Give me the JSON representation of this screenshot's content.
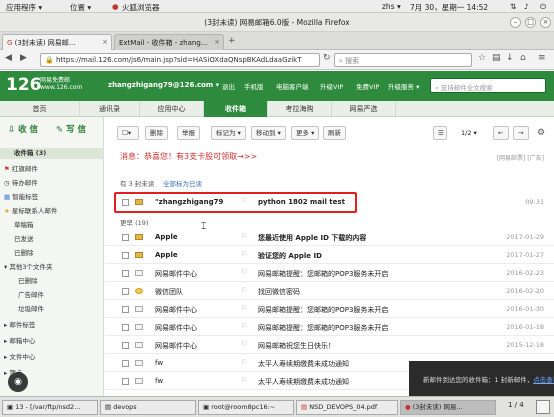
{
  "gnome": {
    "apps": "应用程序 ▾",
    "places": "位置 ▾",
    "app_name": "火狐浏览器",
    "user": "zhs ▾",
    "time": "7月 30，星期一 14:52",
    "status_icons": [
      "network-icon",
      "volume-icon",
      "power-icon"
    ]
  },
  "window": {
    "title": "(3封未读) 网易邮箱6.0版 - Mozilla Firefox"
  },
  "tabs": [
    {
      "label": "(3封未读) 网易邮...",
      "active": true
    },
    {
      "label": "ExtMail - 收件箱 - zhang...",
      "active": false
    }
  ],
  "nav": {
    "url": "https://mail.126.com/js6/main.jsp?sid=HASiOXdaQNspBKAdLdaaGzikT",
    "search_placeholder": "搜索"
  },
  "mail_header": {
    "logo": "126",
    "logo_sub1": "网易免费邮",
    "logo_sub2": "www.126.com",
    "user": "zhangzhigang79@126.com ▾",
    "links": [
      "退出",
      "手机版",
      "电脑客户端",
      "升级VIP",
      "免费VIP",
      "升级服务 ▾",
      "设置 ▾"
    ],
    "search_placeholder": "支持邮件全文搜索"
  },
  "mail_tabs": [
    "首页",
    "通讯录",
    "应用中心",
    "收件箱",
    "考拉海购",
    "网易严选"
  ],
  "sidebar": {
    "receive": "收 信",
    "compose": "写 信",
    "items": [
      {
        "label": "收件箱 (3)",
        "sel": true
      },
      {
        "label": "红旗邮件"
      },
      {
        "label": "待办邮件"
      },
      {
        "label": "智能标签"
      },
      {
        "label": "星标联系人邮件"
      },
      {
        "label": "草稿箱"
      },
      {
        "label": "已发送"
      },
      {
        "label": "已删除"
      },
      {
        "label": "其他3个文件夹"
      },
      {
        "label": "已删除"
      },
      {
        "label": "广告邮件"
      },
      {
        "label": "垃圾邮件"
      },
      {
        "label": "邮件标签"
      },
      {
        "label": "邮箱中心"
      },
      {
        "label": "文件中心"
      },
      {
        "label": "贺卡"
      }
    ]
  },
  "toolbar": {
    "delete": "删除",
    "report": "举报",
    "mark": "标记为 ▾",
    "move": "移动到 ▾",
    "more": "更多 ▾",
    "refresh": "刷新",
    "page": "1/2 ▾"
  },
  "promo": {
    "text": "消息：恭喜您！有3支卡股可领取→>>",
    "right": "[网易邮票] [广告]"
  },
  "filter": {
    "unread": "有 3 封未读",
    "mark_all": "全部标为已读"
  },
  "section_earlier": "更早 (19)",
  "emails": [
    {
      "sender": "\"zhangzhigang79",
      "subject": "python 1802 mail test",
      "date": "09:31",
      "bold": true,
      "highlight": true
    },
    {
      "sender": "Apple",
      "subject": "您最近使用 Apple ID 下载的内容",
      "date": "2017-01-29",
      "bold": true
    },
    {
      "sender": "Apple",
      "subject": "验证您的 Apple ID",
      "date": "2017-01-27",
      "bold": true
    },
    {
      "sender": "网易邮件中心",
      "subject": "网易邮箱提醒：您邮箱的POP3服务未开启",
      "date": "2016-02-23"
    },
    {
      "sender": "微信团队",
      "subject": "找回微信密码",
      "date": "2016-02-20"
    },
    {
      "sender": "网易邮件中心",
      "subject": "网易邮箱提醒：您邮箱的POP3服务未开启",
      "date": "2016-01-30"
    },
    {
      "sender": "网易邮件中心",
      "subject": "网易邮箱提醒：您邮箱的POP3服务未开启",
      "date": "2016-01-18"
    },
    {
      "sender": "网易邮件中心",
      "subject": "网易邮箱祝您生日快乐！",
      "date": "2015-12-18"
    },
    {
      "sender": "fw",
      "subject": "太平人寿续期缴费未成功通知",
      "date": ""
    },
    {
      "sender": "fw",
      "subject": "太平人寿续期缴费未成功通知",
      "date": ""
    }
  ],
  "notification": {
    "text": "新邮件到达您的收件箱：1 封新邮件，",
    "link": "点击查看"
  },
  "taskbar": [
    {
      "label": "13 - [/var/ftp/nsd2..."
    },
    {
      "label": "devops"
    },
    {
      "label": "root@room8pc16:~"
    },
    {
      "label": "NSD_DEVOPS_04.pdf"
    },
    {
      "label": "(3封未读) 网易..."
    }
  ],
  "workspace": "1 / 4"
}
